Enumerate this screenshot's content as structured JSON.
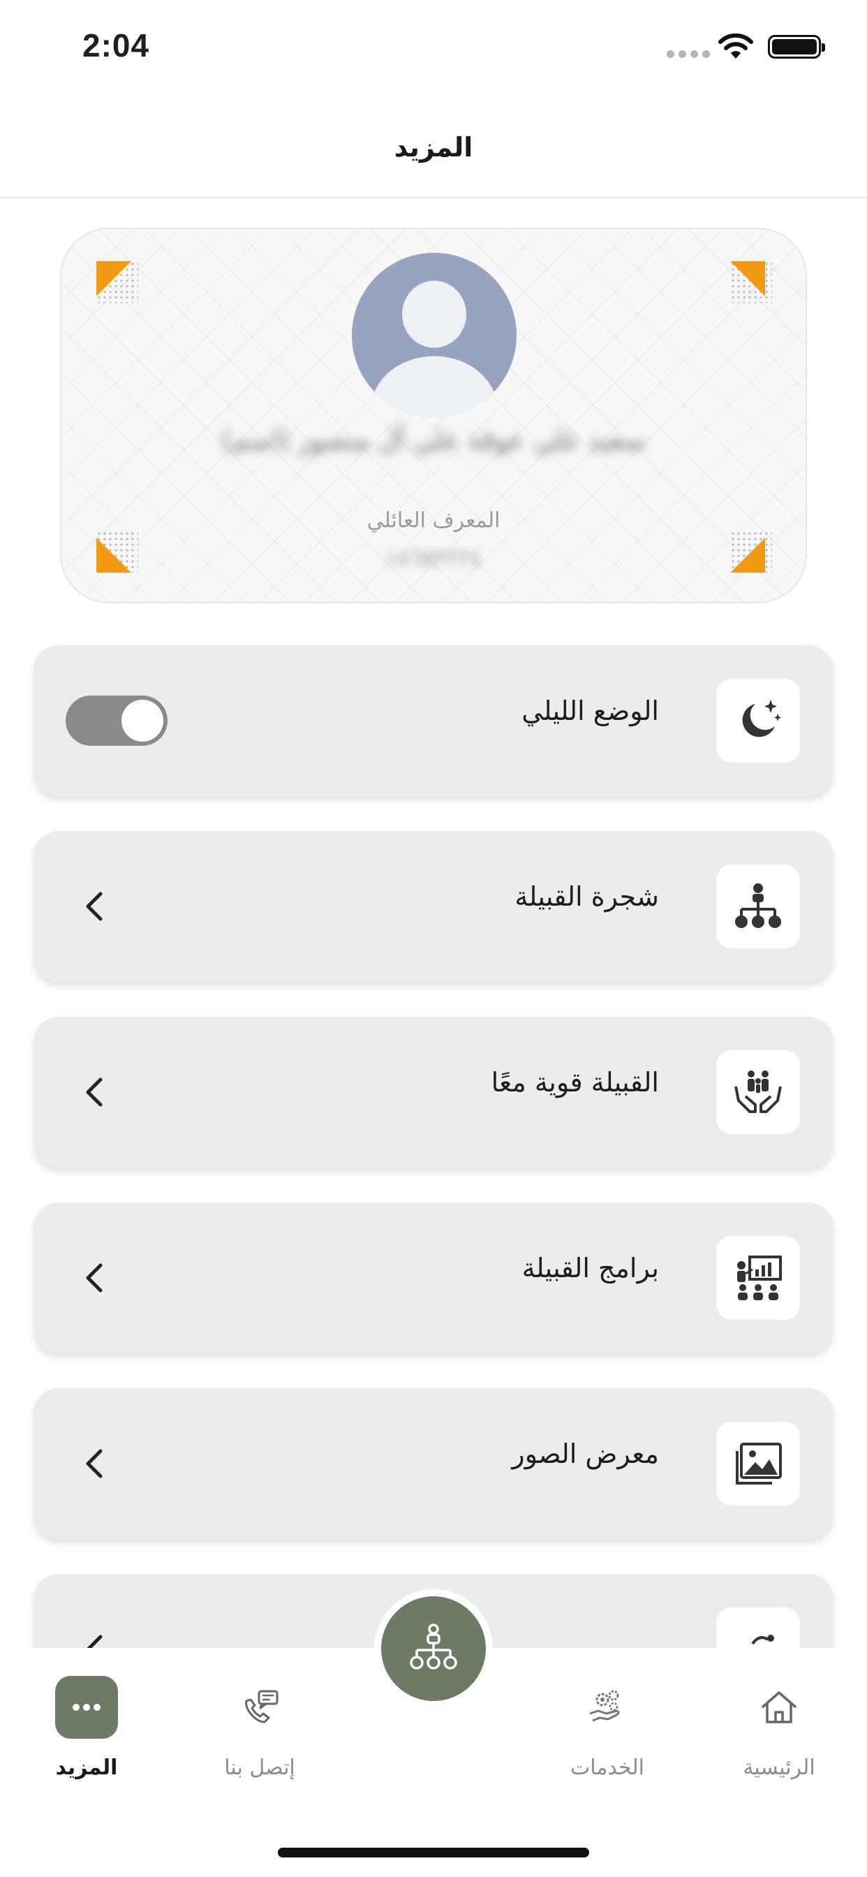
{
  "status_bar": {
    "time": "2:04"
  },
  "header": {
    "title": "المزيد"
  },
  "profile": {
    "member_name": "سعيد علي عوقة علي آل منصور (اسم)",
    "family_id_label": "المعرف العائلي",
    "family_id_value": "١٨٦٥٢٢٢٤"
  },
  "menu": {
    "items": [
      {
        "label": "الوضع الليلي",
        "icon": "moon-stars-icon",
        "toggle_on": true
      },
      {
        "label": "شجرة القبيلة",
        "icon": "family-tree-icon"
      },
      {
        "label": "القبيلة قوية معًا",
        "icon": "family-hands-icon"
      },
      {
        "label": "برامج القبيلة",
        "icon": "presentation-icon"
      },
      {
        "label": "معرض الصور",
        "icon": "gallery-icon"
      },
      {
        "label": "",
        "icon": "partial-icon"
      }
    ]
  },
  "tab_bar": {
    "tabs": [
      {
        "label": "المزيد",
        "icon": "more-dots-icon",
        "active": true
      },
      {
        "label": "إتصل بنا",
        "icon": "phone-chat-icon"
      },
      {
        "label": "الخدمات",
        "icon": "services-gear-icon"
      },
      {
        "label": "الرئيسية",
        "icon": "home-icon"
      }
    ],
    "center_icon": "family-tree-icon"
  },
  "colors": {
    "accent": "#6c7a66",
    "corner_accent": "#f29a14",
    "avatar_bg": "#98a3bf",
    "card_bg": "#ececec"
  }
}
